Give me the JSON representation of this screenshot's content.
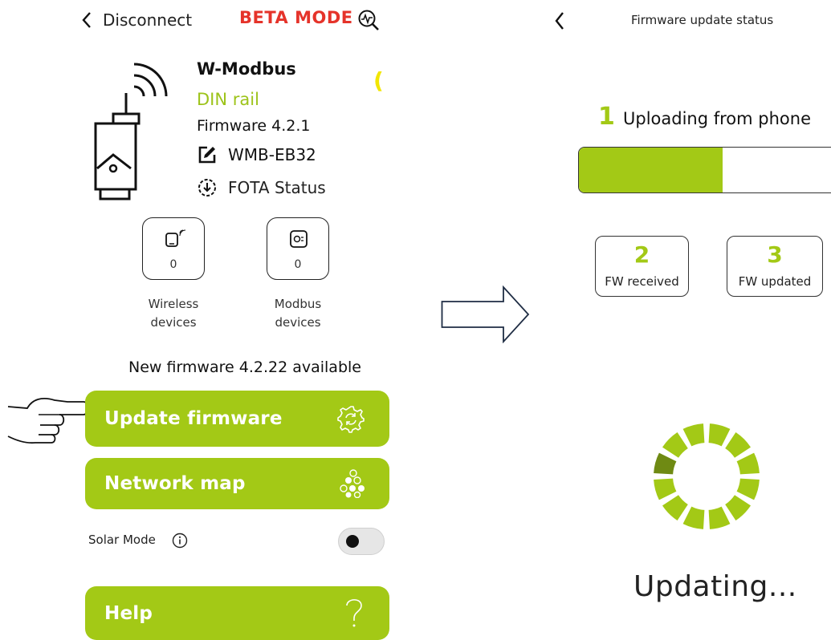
{
  "left_screen": {
    "header": {
      "back_label": "Disconnect",
      "mode_badge": "BETA MODE"
    },
    "device": {
      "name": "W-Modbus",
      "mount": "DIN rail",
      "firmware_label": "Firmware 4.2.1",
      "id_label": "WMB-EB32",
      "fota_label": "FOTA Status",
      "edge_glyph": "("
    },
    "counters": [
      {
        "count": "0",
        "label_line1": "Wireless",
        "label_line2": "devices"
      },
      {
        "count": "0",
        "label_line1": "Modbus",
        "label_line2": "devices"
      }
    ],
    "firmware_notice": "New firmware 4.2.22 available",
    "buttons": {
      "update": "Update firmware",
      "network": "Network map",
      "help": "Help"
    },
    "solar_mode": {
      "label": "Solar Mode",
      "enabled": false
    },
    "colors": {
      "accent": "#a3c916",
      "beta": "#e5332a",
      "mount_text": "#9dc31a"
    }
  },
  "right_screen": {
    "header": {
      "title": "Firmware update status"
    },
    "steps": [
      {
        "number": "1",
        "label": "Uploading from phone"
      },
      {
        "number": "2",
        "label": "FW received"
      },
      {
        "number": "3",
        "label": "FW updated"
      }
    ],
    "progress_fraction": 0.53,
    "status_text": "Updating..."
  }
}
